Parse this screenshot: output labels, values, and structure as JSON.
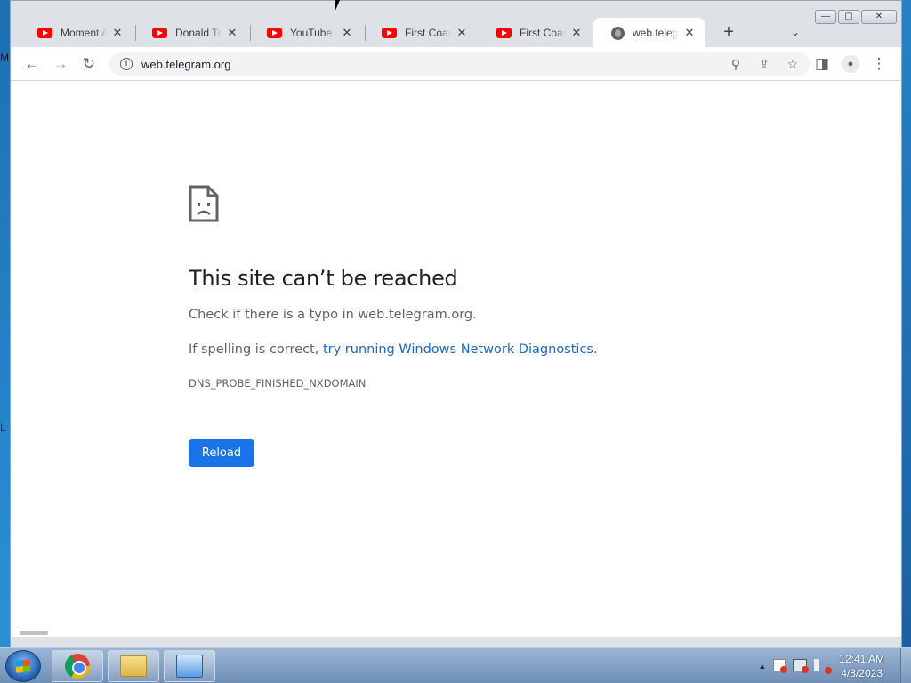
{
  "desktop": {
    "edge_text": "M",
    "edge_text2": "L"
  },
  "browser": {
    "tabs": [
      {
        "title": "Moment Alc",
        "icon": "youtube-icon",
        "active": false
      },
      {
        "title": "Donald Trun",
        "icon": "youtube-icon",
        "active": false
      },
      {
        "title": "YouTube",
        "icon": "youtube-icon",
        "active": false
      },
      {
        "title": "First Coast N",
        "icon": "youtube-icon",
        "active": false
      },
      {
        "title": "First Coast N",
        "icon": "youtube-icon",
        "active": false
      },
      {
        "title": "web.telegra",
        "icon": "globe-icon",
        "active": true
      }
    ],
    "tab_close_glyph": "✕",
    "new_tab_glyph": "+",
    "tab_search_glyph": "⌄",
    "window_controls": {
      "minimize": "—",
      "maximize": "▢",
      "close": "✕"
    },
    "toolbar": {
      "back_glyph": "←",
      "forward_glyph": "→",
      "reload_glyph": "↻",
      "info_glyph": "i",
      "url": "web.telegram.org",
      "zoom_glyph": "⚲",
      "share_glyph": "⇪",
      "bookmark_glyph": "☆",
      "sidepanel_glyph": "◨",
      "profile_glyph": "●",
      "menu_glyph": "⋮"
    }
  },
  "error_page": {
    "title": "This site can’t be reached",
    "line1": "Check if there is a typo in web.telegram.org.",
    "line2_prefix": "If spelling is correct, ",
    "line2_link": "try running Windows Network Diagnostics",
    "line2_suffix": ".",
    "error_code": "DNS_PROBE_FINISHED_NXDOMAIN",
    "reload_label": "Reload"
  },
  "taskbar": {
    "apps": [
      "chrome-icon",
      "folder-icon",
      "control-panel-icon"
    ],
    "tray_arrow": "▲",
    "clock_time": "12:41 AM",
    "clock_date": "4/8/2023"
  },
  "colors": {
    "accent": "#1a73e8",
    "link": "#1967d2",
    "title": "#202124",
    "secondary_text": "#5f6368"
  }
}
